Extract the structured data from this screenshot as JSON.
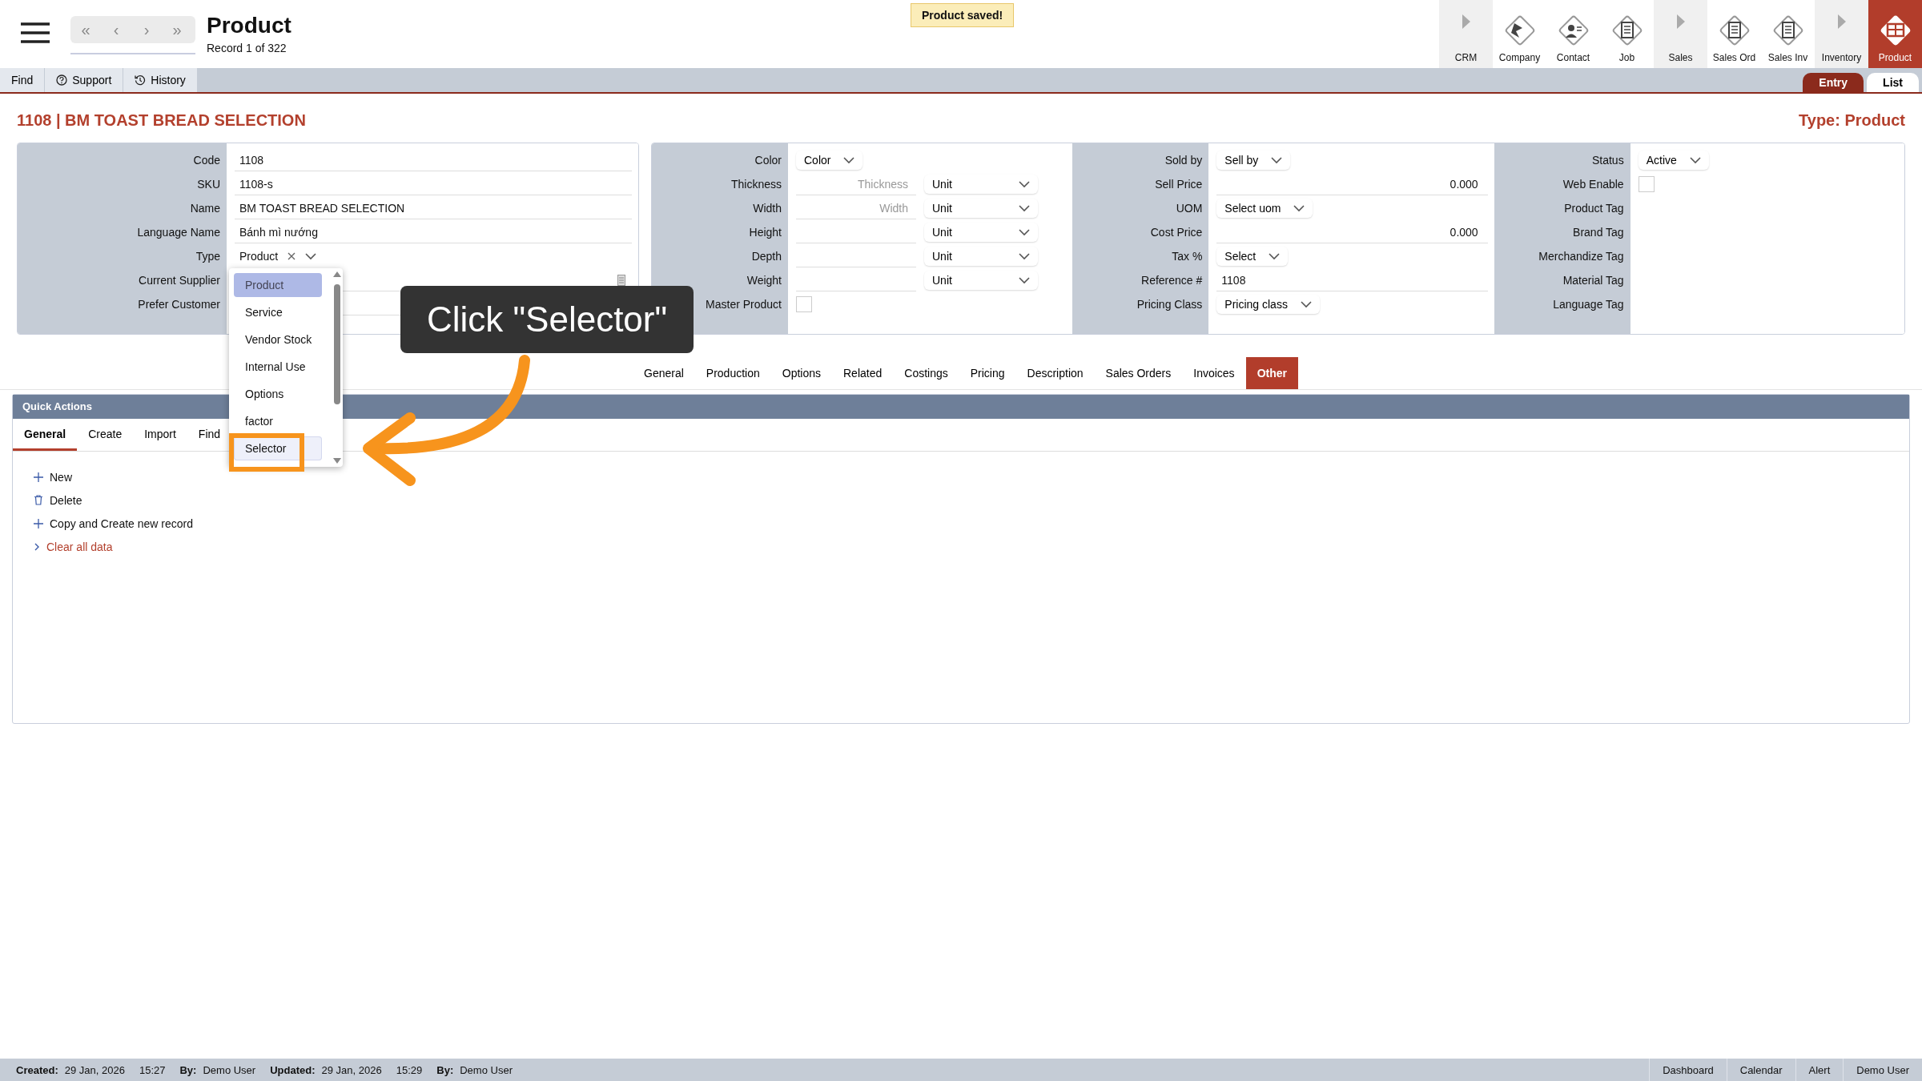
{
  "header": {
    "nav": [
      "«",
      "‹",
      "›",
      "»"
    ],
    "title": "Product",
    "subtitle": "Record 1 of 322",
    "toast": "Product saved!",
    "modules": [
      {
        "label": "CRM",
        "kind": "arrow",
        "selected": false
      },
      {
        "label": "Company",
        "kind": "flag",
        "selected": false
      },
      {
        "label": "Contact",
        "kind": "person",
        "selected": false
      },
      {
        "label": "Job",
        "kind": "document",
        "selected": false
      },
      {
        "label": "Sales",
        "kind": "arrow",
        "selected": false
      },
      {
        "label": "Sales Ord",
        "kind": "document",
        "selected": false
      },
      {
        "label": "Sales Inv",
        "kind": "document",
        "selected": false
      },
      {
        "label": "Inventory",
        "kind": "arrow",
        "selected": false
      },
      {
        "label": "Product",
        "kind": "grid",
        "selected": true
      }
    ]
  },
  "toolbar": {
    "buttons": [
      {
        "label": "Find",
        "kind": "plain"
      },
      {
        "label": "Support",
        "kind": "help"
      },
      {
        "label": "History",
        "kind": "history"
      }
    ],
    "views": [
      {
        "label": "Entry",
        "selected": true
      },
      {
        "label": "List",
        "selected": false
      }
    ]
  },
  "record": {
    "title": "1108 | BM TOAST BREAD SELECTION",
    "type_label": "Type: Product"
  },
  "panels": [
    {
      "fields": [
        {
          "label": "Code",
          "kind": "text",
          "value": "1108"
        },
        {
          "label": "SKU",
          "kind": "text",
          "value": "1108-s"
        },
        {
          "label": "Name",
          "kind": "text",
          "value": "BM TOAST BREAD SELECTION"
        },
        {
          "label": "Language Name",
          "kind": "text",
          "value": "Bánh mì nướng"
        },
        {
          "label": "Type",
          "kind": "clearable",
          "value": "Product"
        },
        {
          "label": "Current Supplier",
          "kind": "lookup"
        },
        {
          "label": "Prefer Customer",
          "kind": "lookup"
        }
      ]
    },
    {
      "fields": [
        {
          "label": "Color",
          "kind": "select",
          "value": "Color"
        },
        {
          "label": "Thickness",
          "kind": "measure",
          "placeholder": "Thickness",
          "unit": "Unit"
        },
        {
          "label": "Width",
          "kind": "measure",
          "placeholder": "Width",
          "unit": "Unit"
        },
        {
          "label": "Height",
          "kind": "measure",
          "unit": "Unit"
        },
        {
          "label": "Depth",
          "kind": "measure",
          "unit": "Unit"
        },
        {
          "label": "Weight",
          "kind": "measure",
          "unit": "Unit"
        },
        {
          "label": "Master Product",
          "kind": "checkbox",
          "checked": false
        }
      ]
    },
    {
      "fields": [
        {
          "label": "Sold by",
          "kind": "select",
          "value": "Sell by"
        },
        {
          "label": "Sell Price",
          "kind": "number",
          "value": "0.000"
        },
        {
          "label": "UOM",
          "kind": "select",
          "value": "Select uom"
        },
        {
          "label": "Cost Price",
          "kind": "number",
          "value": "0.000"
        },
        {
          "label": "Tax %",
          "kind": "select",
          "value": "Select"
        },
        {
          "label": "Reference #",
          "kind": "text",
          "value": "1108"
        },
        {
          "label": "Pricing Class",
          "kind": "select",
          "value": "Pricing class"
        }
      ]
    },
    {
      "fields": [
        {
          "label": "Status",
          "kind": "select",
          "value": "Active"
        },
        {
          "label": "Web Enable",
          "kind": "checkbox",
          "checked": false
        },
        {
          "label": "Product Tag",
          "kind": "tag"
        },
        {
          "label": "Brand Tag",
          "kind": "tag"
        },
        {
          "label": "Merchandize Tag",
          "kind": "tag"
        },
        {
          "label": "Material Tag",
          "kind": "tag"
        },
        {
          "label": "Language Tag",
          "kind": "tag"
        }
      ]
    }
  ],
  "record_tabs": [
    {
      "label": "General",
      "selected": false
    },
    {
      "label": "Production",
      "selected": false
    },
    {
      "label": "Options",
      "selected": false
    },
    {
      "label": "Related",
      "selected": false
    },
    {
      "label": "Costings",
      "selected": false
    },
    {
      "label": "Pricing",
      "selected": false
    },
    {
      "label": "Description",
      "selected": false
    },
    {
      "label": "Sales Orders",
      "selected": false
    },
    {
      "label": "Invoices",
      "selected": false
    },
    {
      "label": "Other",
      "selected": true
    }
  ],
  "quick_actions": {
    "title": "Quick Actions",
    "tabs": [
      {
        "label": "General",
        "selected": true
      },
      {
        "label": "Create",
        "selected": false
      },
      {
        "label": "Import",
        "selected": false
      },
      {
        "label": "Find",
        "selected": false
      }
    ],
    "actions": [
      {
        "label": "New",
        "kind": "add"
      },
      {
        "label": "Delete",
        "kind": "delete"
      },
      {
        "label": "Copy and Create new record",
        "kind": "add"
      },
      {
        "label": "Clear all data",
        "kind": "danger"
      }
    ]
  },
  "type_dropdown": {
    "options": [
      {
        "label": "Product",
        "selected": true,
        "hovered": false
      },
      {
        "label": "Service",
        "selected": false,
        "hovered": false
      },
      {
        "label": "Vendor Stock",
        "selected": false,
        "hovered": false
      },
      {
        "label": "Internal Use",
        "selected": false,
        "hovered": false
      },
      {
        "label": "Options",
        "selected": false,
        "hovered": false
      },
      {
        "label": "factor",
        "selected": false,
        "hovered": false
      },
      {
        "label": "Selector",
        "selected": false,
        "hovered": true
      }
    ]
  },
  "annotation": {
    "callout": "Click \"Selector\""
  },
  "status_bar": {
    "left": [
      {
        "label": "Created:",
        "value": "29 Jan, 2026"
      },
      {
        "value": "15:27"
      },
      {
        "label": "By:",
        "value": "Demo User"
      },
      {
        "label": "Updated:",
        "value": "29 Jan, 2026"
      },
      {
        "value": "15:29"
      },
      {
        "label": "By:",
        "value": "Demo User"
      }
    ],
    "links": [
      "Dashboard",
      "Calendar",
      "Alert",
      "Demo User"
    ]
  }
}
